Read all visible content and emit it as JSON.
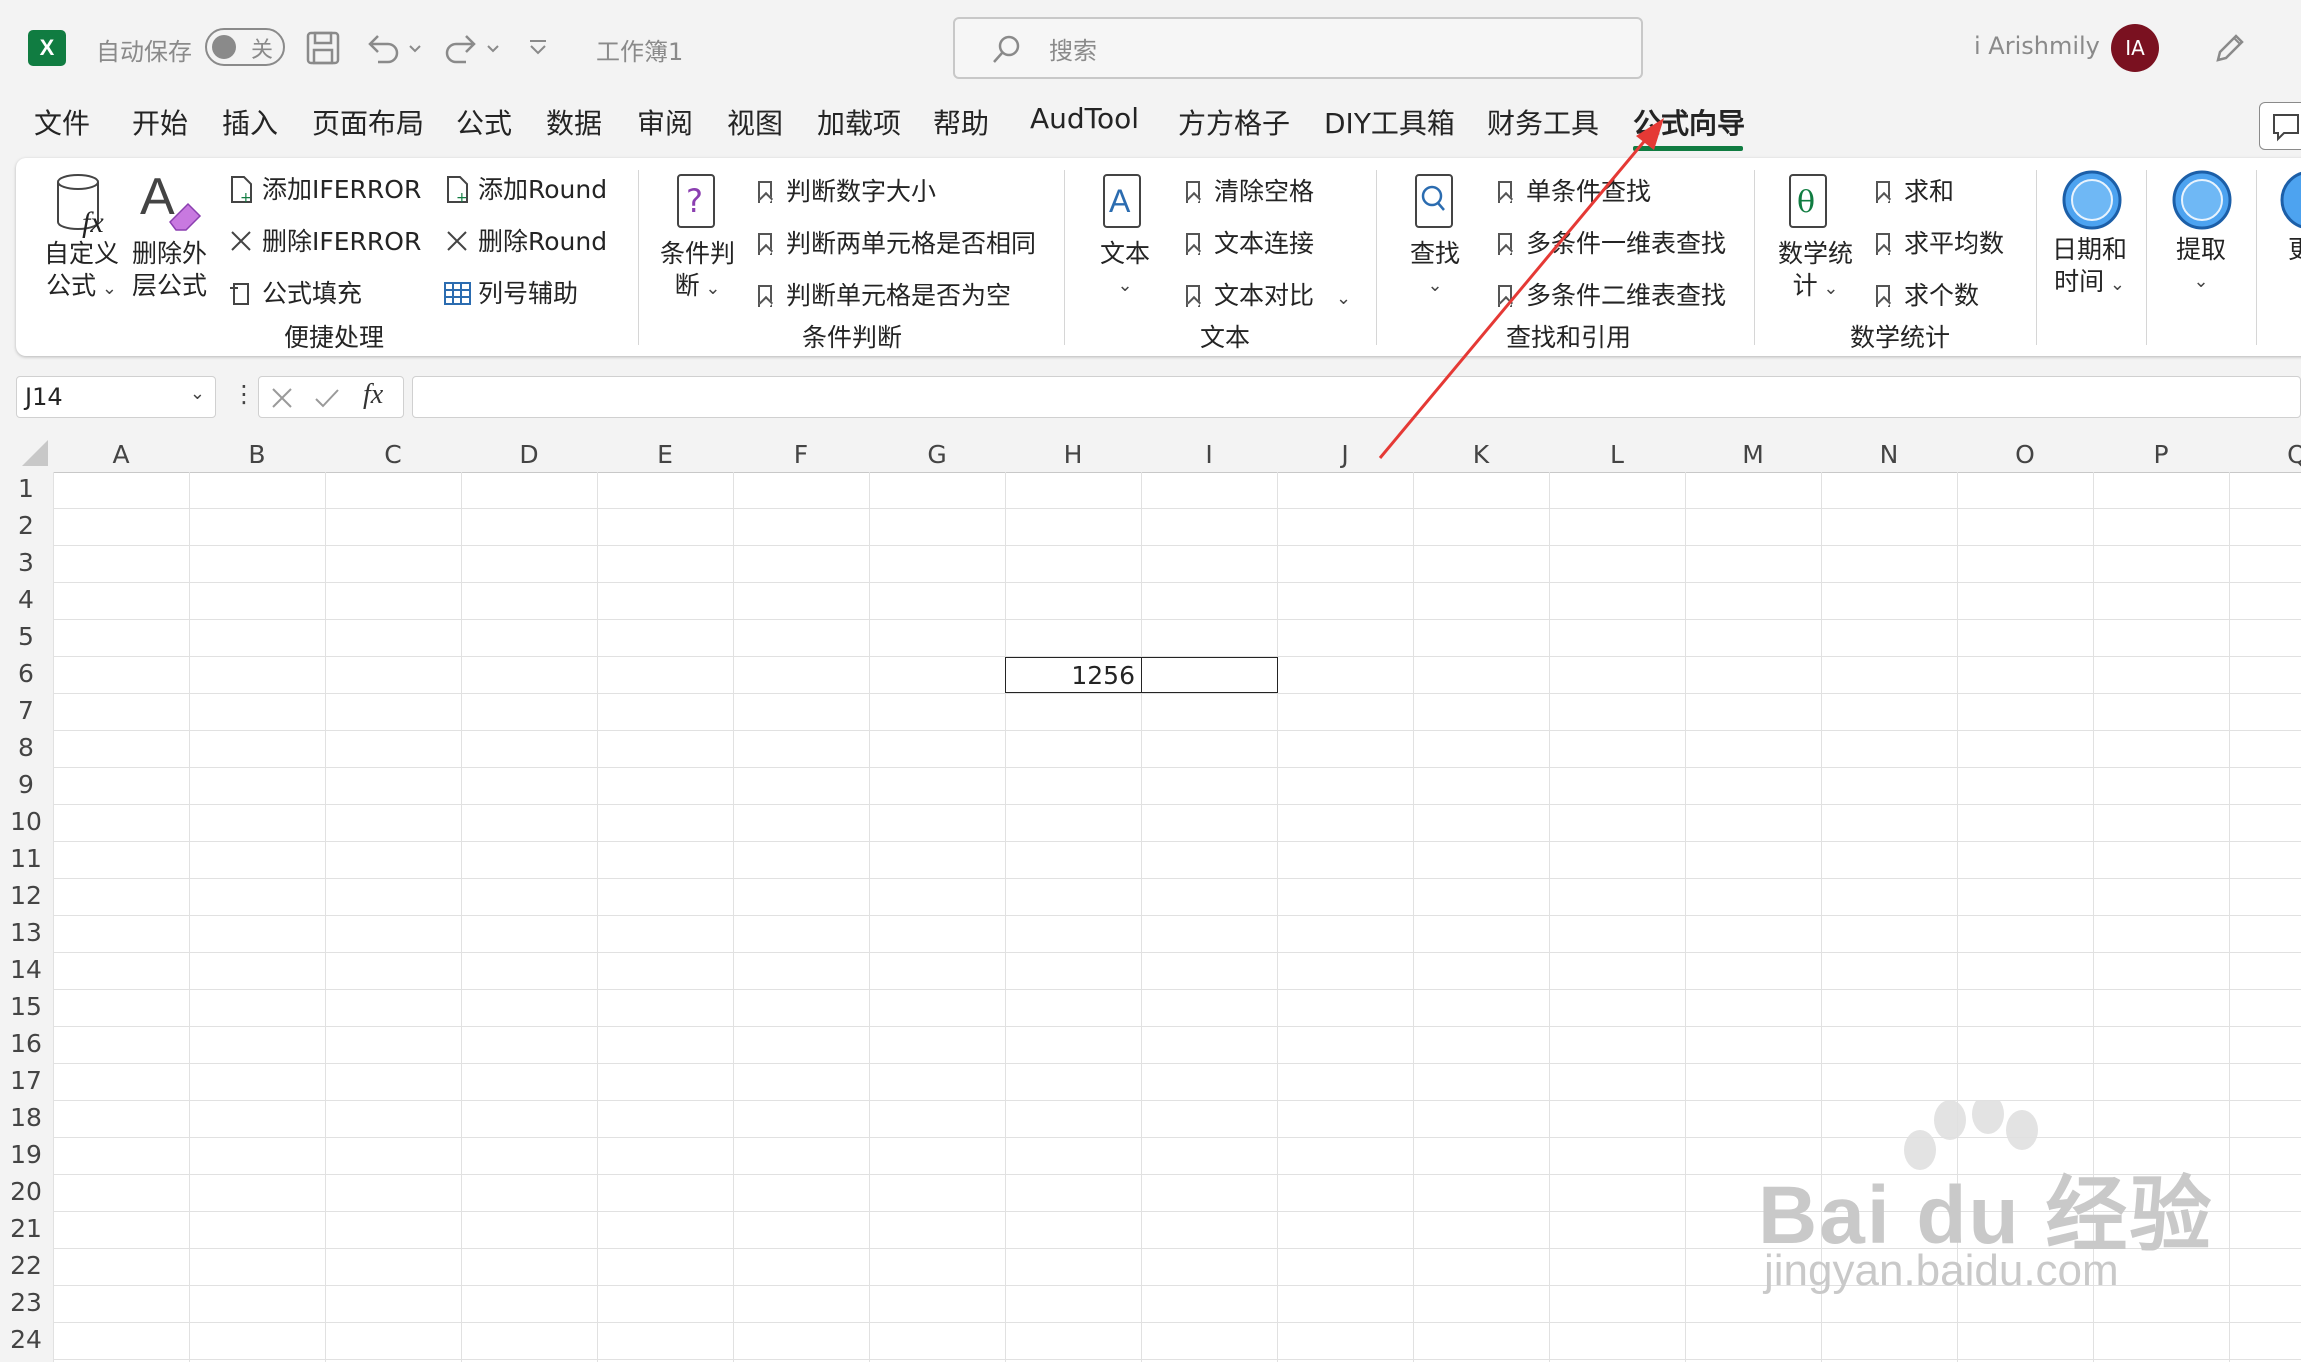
{
  "titlebar": {
    "app_logo": "X",
    "autosave_label": "自动保存",
    "autosave_state": "关",
    "workbook_name": "工作簿1",
    "search_placeholder": "搜索",
    "user_name": "i Arishmily",
    "user_initials": "IA"
  },
  "menu": {
    "items": [
      "文件",
      "开始",
      "插入",
      "页面布局",
      "公式",
      "数据",
      "审阅",
      "视图",
      "加载项",
      "帮助",
      "AudTool",
      "方方格子",
      "DIY工具箱",
      "财务工具",
      "公式向导"
    ],
    "active": "公式向导"
  },
  "ribbon": {
    "quick": {
      "custom_formula": [
        "自定义",
        "公式"
      ],
      "remove_outer": [
        "删除外",
        "层公式"
      ],
      "add_iferror": "添加IFERROR",
      "del_iferror": "删除IFERROR",
      "formula_fill": "公式填充",
      "add_round": "添加Round",
      "del_round": "删除Round",
      "col_helper": "列号辅助",
      "group": "便捷处理"
    },
    "condition": {
      "big": [
        "条件判",
        "断"
      ],
      "items": [
        "判断数字大小",
        "判断两单元格是否相同",
        "判断单元格是否为空"
      ],
      "group": "条件判断"
    },
    "text": {
      "big": "文本",
      "items": [
        "清除空格",
        "文本连接",
        "文本对比"
      ],
      "group": "文本"
    },
    "lookup": {
      "big": "查找",
      "items": [
        "单条件查找",
        "多条件一维表查找",
        "多条件二维表查找"
      ],
      "group": "查找和引用"
    },
    "math": {
      "big": [
        "数学统",
        "计"
      ],
      "items": [
        "求和",
        "求平均数",
        "求个数"
      ],
      "group": "数学统计"
    },
    "date": [
      "日期和",
      "时间"
    ],
    "extract": "提取",
    "more": "更"
  },
  "formula_bar": {
    "name_box": "J14",
    "fx": "fx",
    "content": ""
  },
  "sheet": {
    "columns": [
      "A",
      "B",
      "C",
      "D",
      "E",
      "F",
      "G",
      "H",
      "I",
      "J",
      "K",
      "L",
      "M",
      "N",
      "O",
      "P",
      "Q"
    ],
    "rows": [
      "1",
      "2",
      "3",
      "4",
      "5",
      "6",
      "7",
      "8",
      "9",
      "10",
      "11",
      "12",
      "13",
      "14",
      "15",
      "16",
      "17",
      "18",
      "19",
      "20",
      "21",
      "22",
      "23",
      "24"
    ],
    "cell_H6": "1256"
  },
  "watermark": {
    "brand": "Bai du 经验",
    "url": "jingyan.baidu.com"
  },
  "colors": {
    "excel_green": "#107c41",
    "arrow_red": "#e53935",
    "avatar": "#7a1120"
  }
}
